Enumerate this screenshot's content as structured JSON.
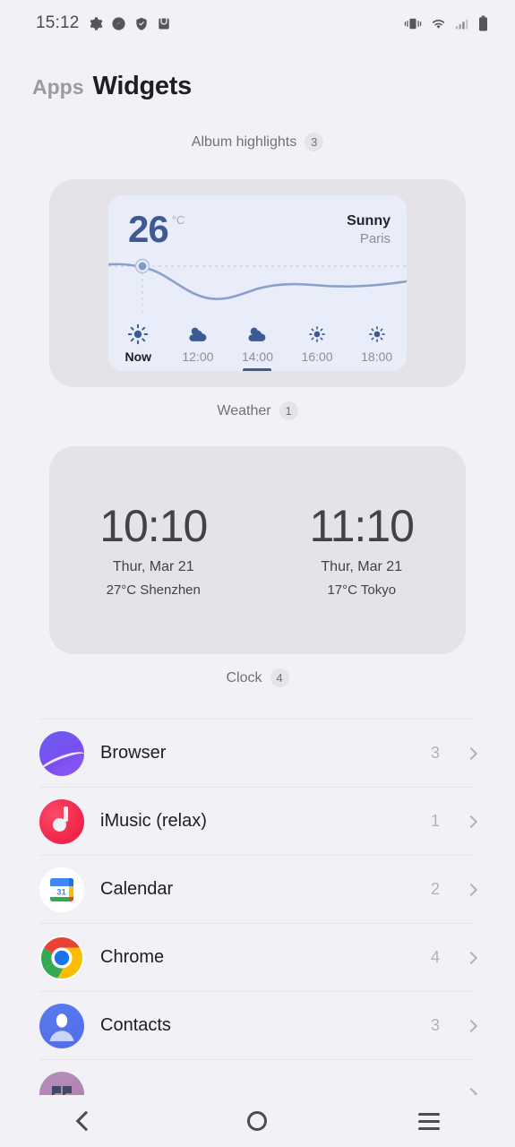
{
  "statusbar": {
    "time": "15:12",
    "left_icons": [
      "gear-icon",
      "speedometer-icon",
      "shield-check-icon",
      "inbox-icon"
    ],
    "right_icons": [
      "vibrate-icon",
      "wifi-icon",
      "signal-icon",
      "battery-icon"
    ]
  },
  "header": {
    "apps_label": "Apps",
    "widgets_label": "Widgets"
  },
  "sections": {
    "album": {
      "label": "Album highlights",
      "count": "3"
    },
    "weather": {
      "label": "Weather",
      "count": "1"
    },
    "clock": {
      "label": "Clock",
      "count": "4"
    }
  },
  "weather_widget": {
    "temperature": "26",
    "unit": "°C",
    "condition": "Sunny",
    "city": "Paris",
    "hours": [
      {
        "label": "Now",
        "icon": "sun-icon",
        "selected": false,
        "current": true
      },
      {
        "label": "12:00",
        "icon": "cloud-sun-icon",
        "selected": false,
        "current": false
      },
      {
        "label": "14:00",
        "icon": "cloud-sun-icon",
        "selected": true,
        "current": false
      },
      {
        "label": "16:00",
        "icon": "sun-icon",
        "selected": false,
        "current": false
      },
      {
        "label": "18:00",
        "icon": "sun-icon",
        "selected": false,
        "current": false
      }
    ],
    "accent_color": "#3e5a94",
    "card_background": "#e9edfa"
  },
  "clock_widget": {
    "clocks": [
      {
        "time": "10:10",
        "date": "Thur,  Mar 21",
        "meta": "27°C  Shenzhen"
      },
      {
        "time": "11:10",
        "date": "Thur,  Mar 21",
        "meta": "17°C  Tokyo"
      }
    ]
  },
  "app_list": [
    {
      "name": "Browser",
      "count": "3",
      "icon": "browser-icon"
    },
    {
      "name": "iMusic (relax)",
      "count": "1",
      "icon": "music-icon"
    },
    {
      "name": "Calendar",
      "count": "2",
      "icon": "calendar-icon",
      "icon_day": "31"
    },
    {
      "name": "Chrome",
      "count": "4",
      "icon": "chrome-icon"
    },
    {
      "name": "Contacts",
      "count": "3",
      "icon": "contacts-icon"
    },
    {
      "name": "",
      "count": "",
      "icon": "conversation-icon"
    }
  ],
  "navbar": {
    "back": "back-icon",
    "home": "home-icon",
    "recents": "recents-icon"
  }
}
